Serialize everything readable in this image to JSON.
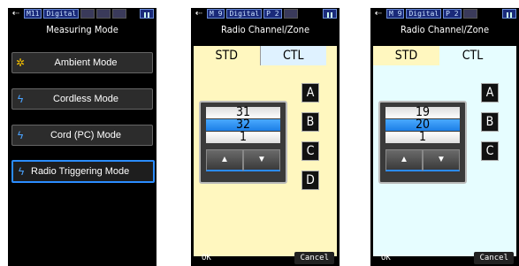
{
  "screen1": {
    "status": {
      "mode": "M11",
      "label": "Digital"
    },
    "title": "Measuring Mode",
    "items": [
      {
        "label": "Ambient Mode",
        "icon": "sun-icon"
      },
      {
        "label": "Cordless Mode",
        "icon": "flash-icon"
      },
      {
        "label": "Cord (PC) Mode",
        "icon": "flash-cord-icon"
      },
      {
        "label": "Radio Triggering Mode",
        "icon": "flash-radio-icon",
        "selected": true
      }
    ]
  },
  "screen2": {
    "status": {
      "mode": "M 9",
      "label": "Digital",
      "page": "P 2"
    },
    "title": "Radio Channel/Zone",
    "tabs": [
      "STD",
      "CTL"
    ],
    "active_tab": "STD",
    "picker": {
      "above": "31",
      "selected": "32",
      "below": "1",
      "up": "▲",
      "down": "▼"
    },
    "zones": [
      "A",
      "B",
      "C",
      "D"
    ],
    "ok": "OK",
    "cancel": "Cancel"
  },
  "screen3": {
    "status": {
      "mode": "M 9",
      "label": "Digital",
      "page": "P 2"
    },
    "title": "Radio Channel/Zone",
    "tabs": [
      "STD",
      "CTL"
    ],
    "active_tab": "CTL",
    "picker": {
      "above": "19",
      "selected": "20",
      "below": "1",
      "up": "▲",
      "down": "▼"
    },
    "zones": [
      "A",
      "B",
      "C"
    ],
    "ok": "OK",
    "cancel": "Cancel"
  }
}
